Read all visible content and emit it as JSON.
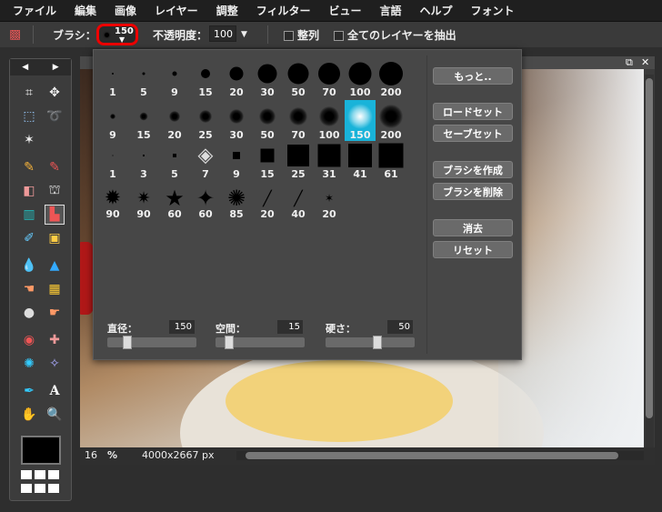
{
  "menu": [
    "ファイル",
    "編集",
    "画像",
    "レイヤー",
    "調整",
    "フィルター",
    "ビュー",
    "言語",
    "ヘルプ",
    "フォント"
  ],
  "toolbar": {
    "brush_label": "ブラシ：",
    "brush_size": "150",
    "opacity_label": "不透明度：",
    "opacity_value": "100",
    "align_label": "整列",
    "sample_all_label": "全てのレイヤーを抽出"
  },
  "popup": {
    "rows": [
      [
        "1",
        "5",
        "9",
        "15",
        "20",
        "30",
        "50",
        "70",
        "100",
        "200"
      ],
      [
        "9",
        "15",
        "20",
        "25",
        "30",
        "50",
        "70",
        "100",
        "150",
        "200"
      ],
      [
        "1",
        "3",
        "5",
        "7",
        "9",
        "15",
        "25",
        "31",
        "41",
        "61"
      ],
      [
        "90",
        "90",
        "60",
        "60",
        "85",
        "20",
        "40",
        "20"
      ]
    ],
    "selected": "150",
    "buttons": [
      "もっと..",
      "ロードセット",
      "セーブセット",
      "ブラシを作成",
      "ブラシを削除",
      "消去",
      "リセット"
    ],
    "sliders": [
      {
        "label": "直径：",
        "value": "150",
        "level": 0.1
      },
      {
        "label": "空間：",
        "value": "15",
        "level": 0.02
      },
      {
        "label": "硬さ：",
        "value": "50",
        "level": 0.5
      }
    ]
  },
  "status": {
    "zoom": "16",
    "percent_sign": "%",
    "dimensions": "4000x2667 px"
  },
  "colors": {
    "accent": "#19b3d9",
    "highlight": "#e00000"
  }
}
